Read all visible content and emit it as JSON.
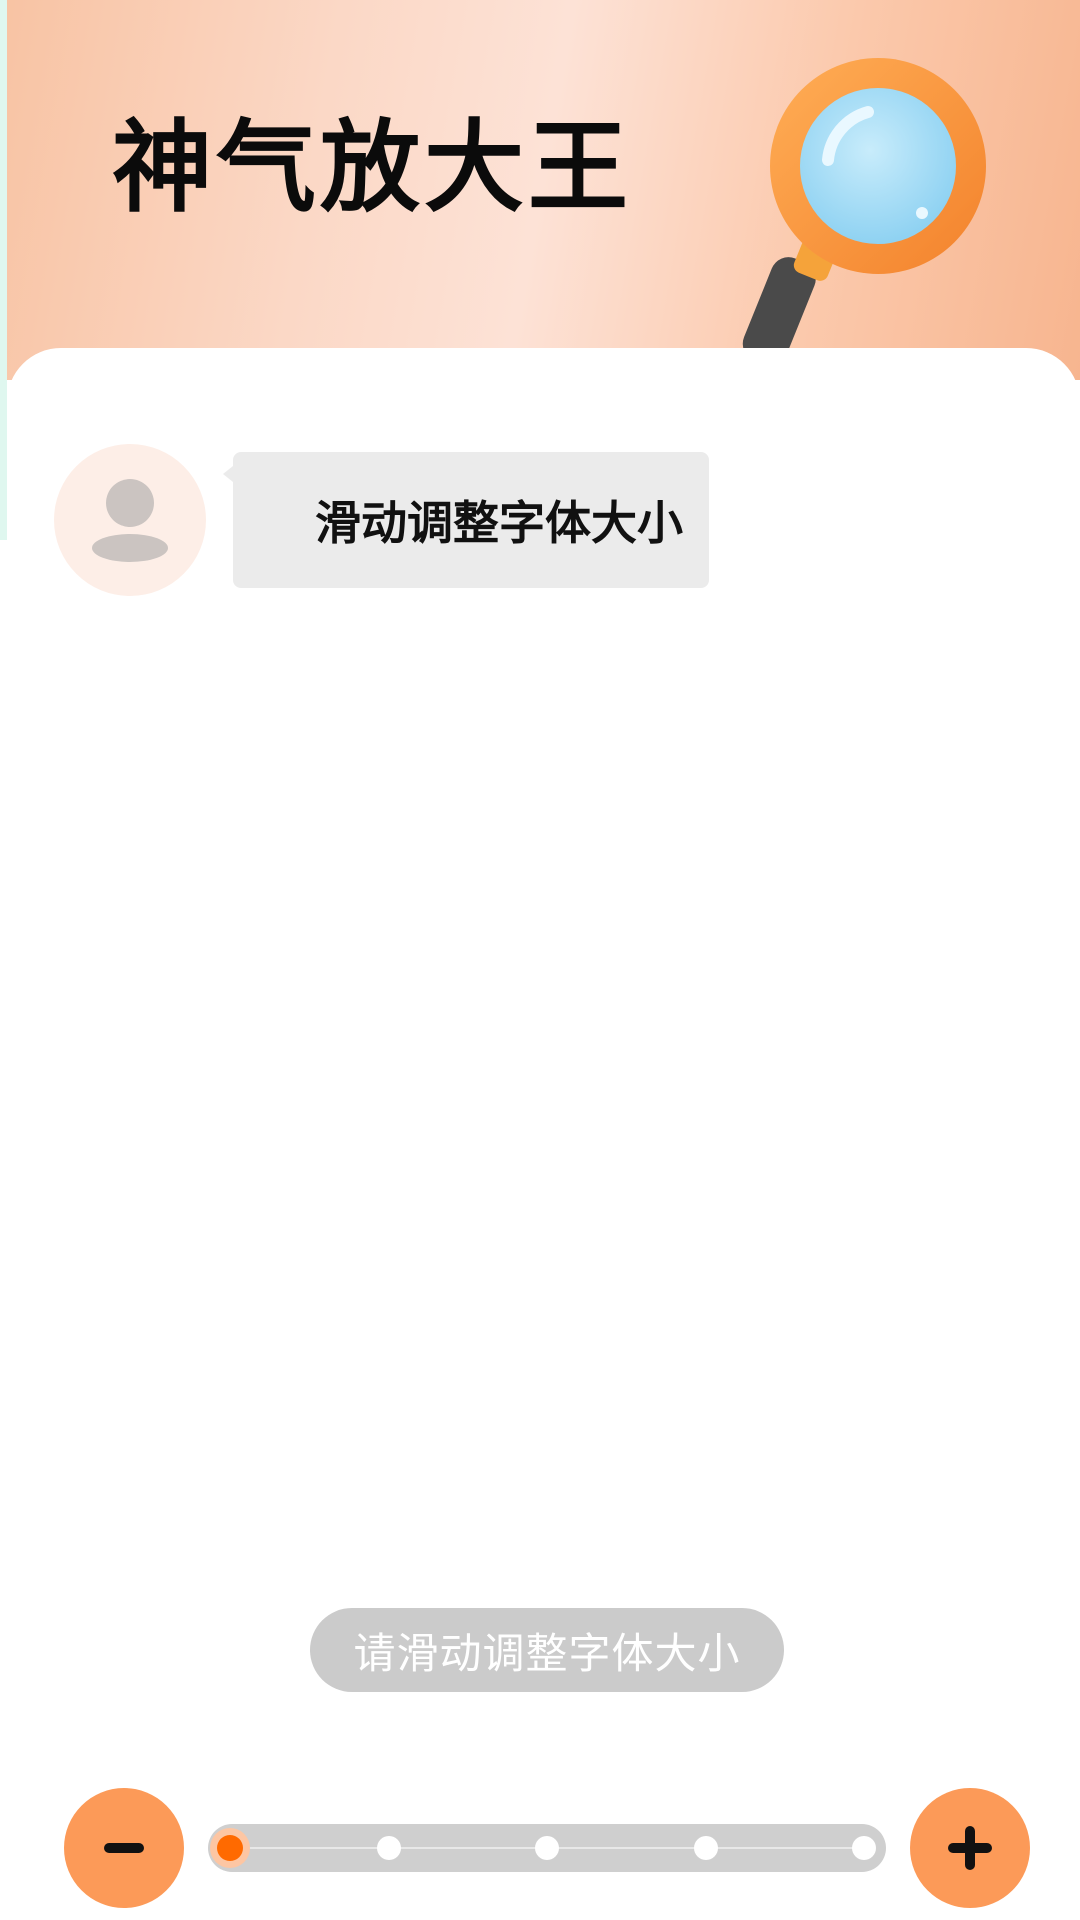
{
  "app": {
    "title": "神气放大王"
  },
  "chat": {
    "message": "滑动调整字体大小"
  },
  "hint": {
    "text": "请滑动调整字体大小"
  },
  "slider": {
    "steps": 5,
    "current_step": 1
  },
  "icons": {
    "header": "magnifying-glass-icon",
    "avatar": "user-avatar-icon",
    "decrease": "minus-icon",
    "increase": "plus-icon"
  },
  "colors": {
    "accent": "#fc9a58",
    "slider_active": "#ff6a00",
    "bubble_bg": "#ebebeb",
    "hint_bg": "#cbcbcb"
  }
}
